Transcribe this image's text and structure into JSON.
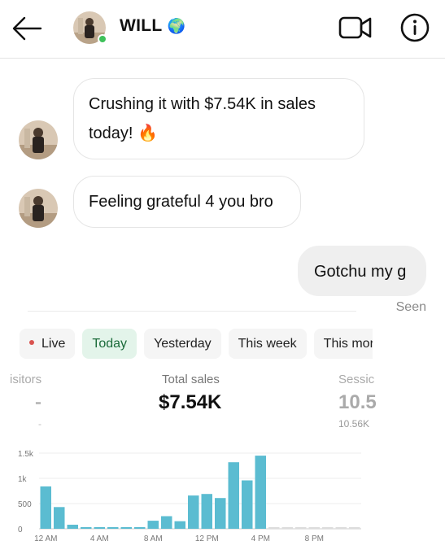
{
  "header": {
    "name": "WILL",
    "globe": "🌍",
    "back_icon": "back-arrow-icon",
    "video_icon": "video-call-icon",
    "info_icon": "info-icon",
    "online_color": "#3ec15a"
  },
  "messages": [
    {
      "from": "them",
      "line1": "Crushing it with $7.54K in sales",
      "line2": "today! 🔥"
    },
    {
      "from": "them",
      "text": "Feeling grateful 4 you bro"
    },
    {
      "from": "me",
      "text": "Gotchu my g",
      "status": "Seen"
    }
  ],
  "dashboard": {
    "filters": [
      "Live",
      "Today",
      "Yesterday",
      "This week",
      "This mor"
    ],
    "active_filter": "Today",
    "visitors_label": "isitors",
    "visitors_value": "-",
    "visitors_sub": "-",
    "total_sales_label": "Total sales",
    "total_sales_value": "$7.54K",
    "sessions_label": "Sessic",
    "sessions_value": "10.5",
    "sessions_sub": "10.56K"
  },
  "chart_data": {
    "type": "bar",
    "y_ticks": [
      "1.5k",
      "1k",
      "500",
      "0"
    ],
    "x_ticks": [
      "12 AM",
      "4 AM",
      "8 AM",
      "12 PM",
      "4 PM",
      "8 PM"
    ],
    "ylim": [
      0,
      1500
    ],
    "hours": [
      0,
      1,
      2,
      3,
      4,
      5,
      6,
      7,
      8,
      9,
      10,
      11,
      12,
      13,
      14,
      15,
      16,
      17,
      18,
      19,
      20,
      21,
      22,
      23
    ],
    "values": [
      840,
      430,
      80,
      20,
      20,
      20,
      20,
      20,
      160,
      250,
      150,
      660,
      690,
      610,
      1320,
      960,
      1450,
      10,
      10,
      10,
      10,
      10,
      10,
      10
    ],
    "bar_color": "#5bbcd1",
    "empty_color": "#dcdcdc",
    "grid": true
  }
}
